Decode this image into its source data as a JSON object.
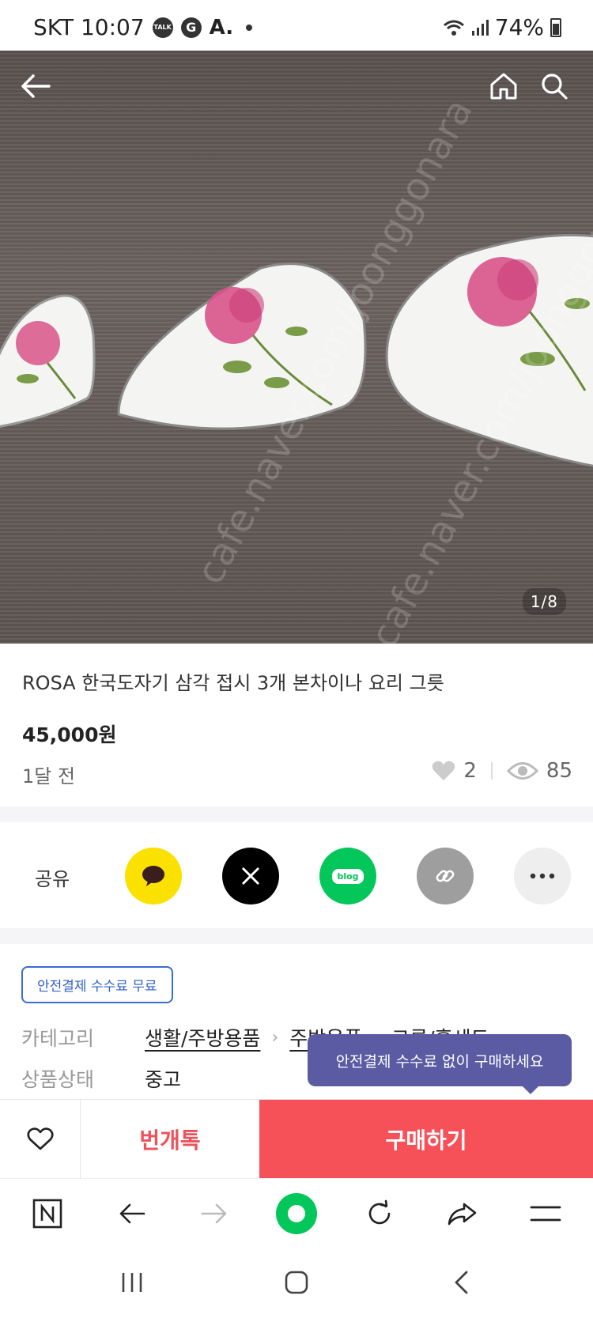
{
  "status_bar": {
    "carrier_time": "SKT 10:07",
    "talk_badge": "TALK",
    "g_badge": "G",
    "a_badge": "A.",
    "battery": "74%"
  },
  "hero": {
    "watermark": "cafe.naver.com/joonggonara",
    "counter": "1/8"
  },
  "product": {
    "title": "ROSA 한국도자기 삼각 접시 3개 본차이나 요리 그릇",
    "price": "45,000원",
    "posted": "1달 전",
    "likes": "2",
    "views": "85"
  },
  "share": {
    "label": "공유",
    "kakao_color": "#fae100",
    "x_color": "#000000",
    "blog_color": "#03c75a",
    "blog_text": "blog",
    "link_color": "#9e9e9e",
    "more_color": "#eeeeee"
  },
  "details": {
    "badge": "안전결제 수수료 무료",
    "category_label": "카테고리",
    "category_1": "생활/주방용품",
    "category_2": "주방용품",
    "category_3": "그릇/홈세트",
    "condition_label": "상품상태",
    "condition_value": "중고",
    "tooltip": "안전결제 수수료 없이 구매하세요"
  },
  "action_bar": {
    "chat_label": "번개톡",
    "buy_label": "구매하기",
    "buy_color": "#f65059"
  }
}
